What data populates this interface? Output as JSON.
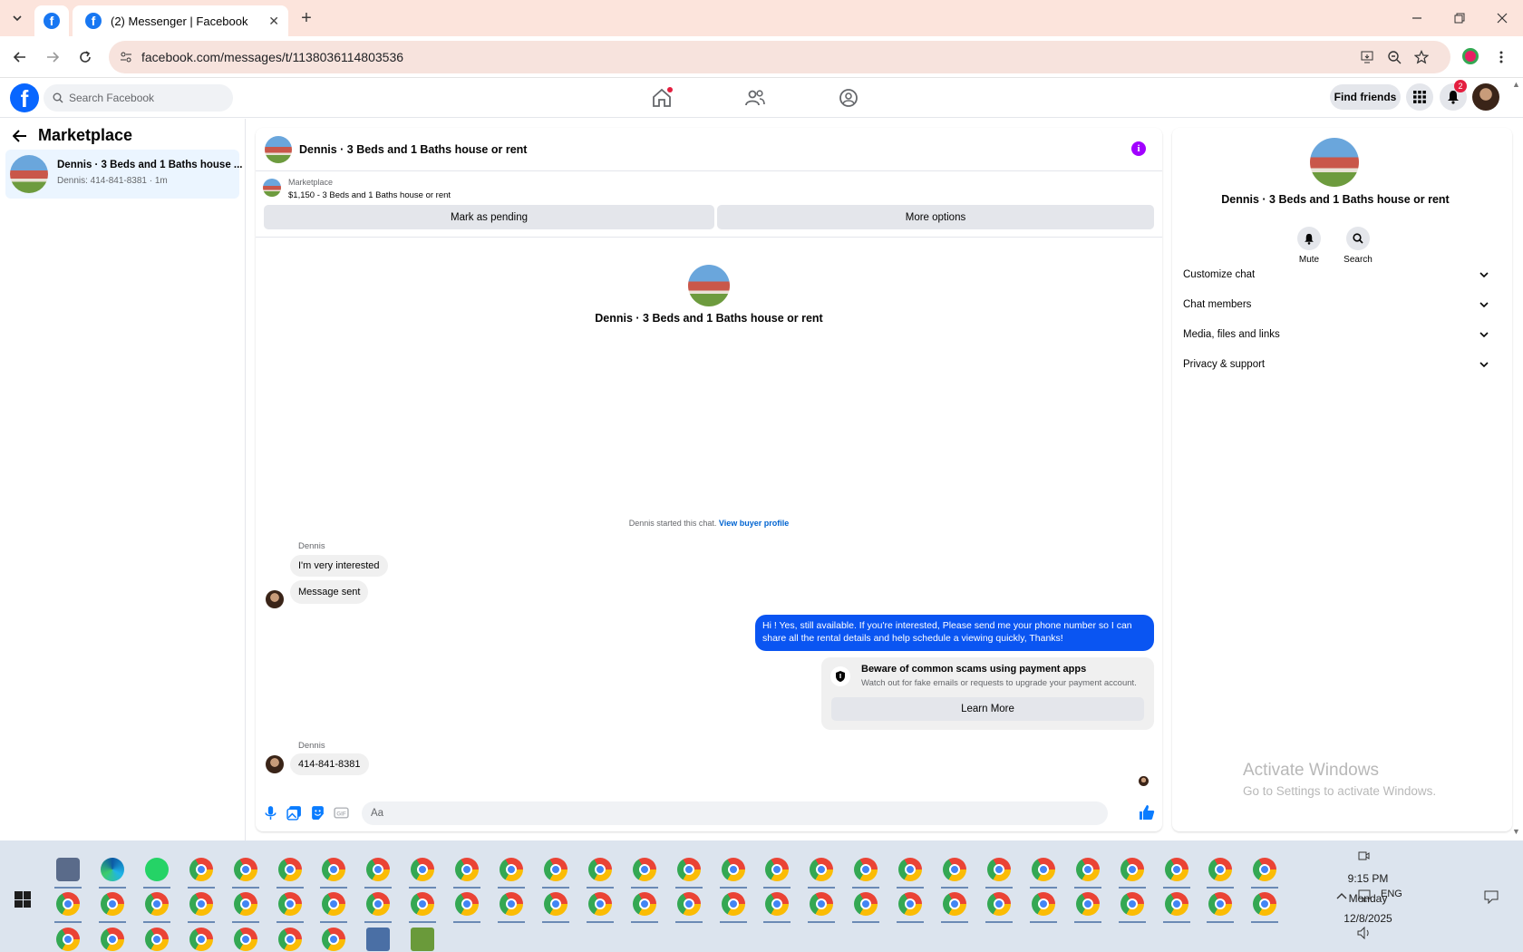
{
  "browser": {
    "tab_title": "(2) Messenger | Facebook",
    "url": "facebook.com/messages/t/1138036114803536"
  },
  "facebook": {
    "search_placeholder": "Search Facebook",
    "find_friends": "Find friends",
    "notification_count": "2"
  },
  "left_panel": {
    "title": "Marketplace",
    "conversations": [
      {
        "title": "Dennis · 3 Beds and 1 Baths house ...",
        "subtitle": "Dennis: 414-841-8381 · 1m"
      }
    ]
  },
  "chat": {
    "header_title": "Dennis · 3 Beds and 1 Baths house or rent",
    "listing": {
      "kicker": "Marketplace",
      "text": "$1,150 - 3 Beds and 1 Baths house or rent",
      "mark_pending": "Mark as pending",
      "more_options": "More options"
    },
    "intro_title": "Dennis · 3 Beds and 1 Baths house or rent",
    "started_text": "Dennis started this chat.",
    "view_profile": "View buyer profile",
    "messages": {
      "sender_1": "Dennis",
      "in_1": "I'm very interested",
      "in_2": "Message sent",
      "out_1": "Hi ! Yes, still available. If you're interested, Please send me your phone number so I can share all the rental details and help schedule a viewing quickly, Thanks!",
      "sender_2": "Dennis",
      "in_3": "414-841-8381"
    },
    "scam_card": {
      "title": "Beware of common scams using payment apps",
      "text": "Watch out for fake emails or requests to upgrade your payment account.",
      "button": "Learn More"
    },
    "composer_placeholder": "Aa"
  },
  "right_panel": {
    "title": "Dennis · 3 Beds and 1 Baths house or rent",
    "mute": "Mute",
    "search": "Search",
    "sections": [
      "Customize chat",
      "Chat members",
      "Media, files and links",
      "Privacy & support"
    ],
    "watermark_title": "Activate Windows",
    "watermark_text": "Go to Settings to activate Windows."
  },
  "taskbar": {
    "time": "9:15 PM",
    "day": "Monday",
    "date": "12/8/2025",
    "lang": "ENG"
  }
}
